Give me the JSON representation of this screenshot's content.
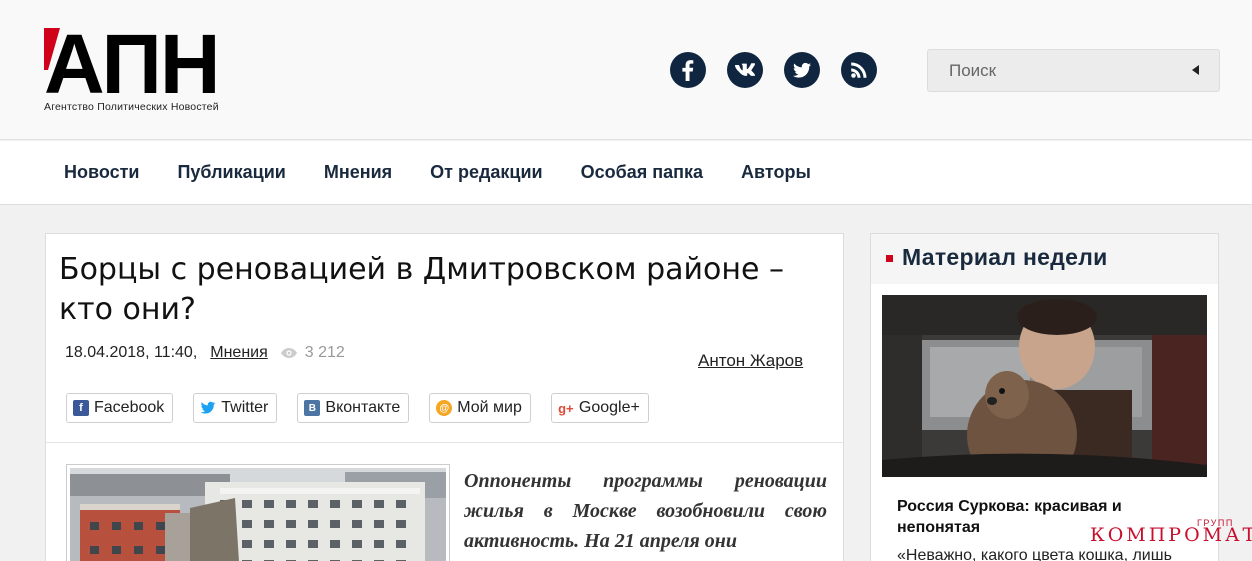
{
  "header": {
    "logo_text": "АПН",
    "logo_subtitle": "Агентство Политических Новостей",
    "socials": [
      {
        "name": "facebook-icon",
        "glyph": "f"
      },
      {
        "name": "vk-icon",
        "glyph": "vk"
      },
      {
        "name": "twitter-icon",
        "glyph": "t"
      },
      {
        "name": "rss-icon",
        "glyph": "rss"
      }
    ],
    "search_placeholder": "Поиск"
  },
  "nav": {
    "items": [
      "Новости",
      "Публикации",
      "Мнения",
      "От редакции",
      "Особая папка",
      "Авторы"
    ]
  },
  "article": {
    "title": "Борцы с реновацией в Дмитровском районе – кто они?",
    "date": "18.04.2018, 11:40,",
    "category": "Мнения",
    "views": "3 212",
    "author": "Антон Жаров",
    "shares": [
      "Facebook",
      "Twitter",
      "Вконтакте",
      "Мой мир",
      "Google+"
    ],
    "lead": "Оппоненты программы реновации жилья в Москве возобновили свою активность. На 21 апреля они"
  },
  "sidebar": {
    "heading": "Материал недели",
    "title": "Россия Суркова: красивая и непонятая",
    "quote": "«Неважно, какого цвета кошка, лишь"
  },
  "watermark": {
    "main": "КОМПРОМАТ",
    "small": "ГРУПП"
  },
  "colors": {
    "brand_red": "#d0021b",
    "nav_text": "#1a2a3e",
    "social_bg": "#10253f"
  }
}
